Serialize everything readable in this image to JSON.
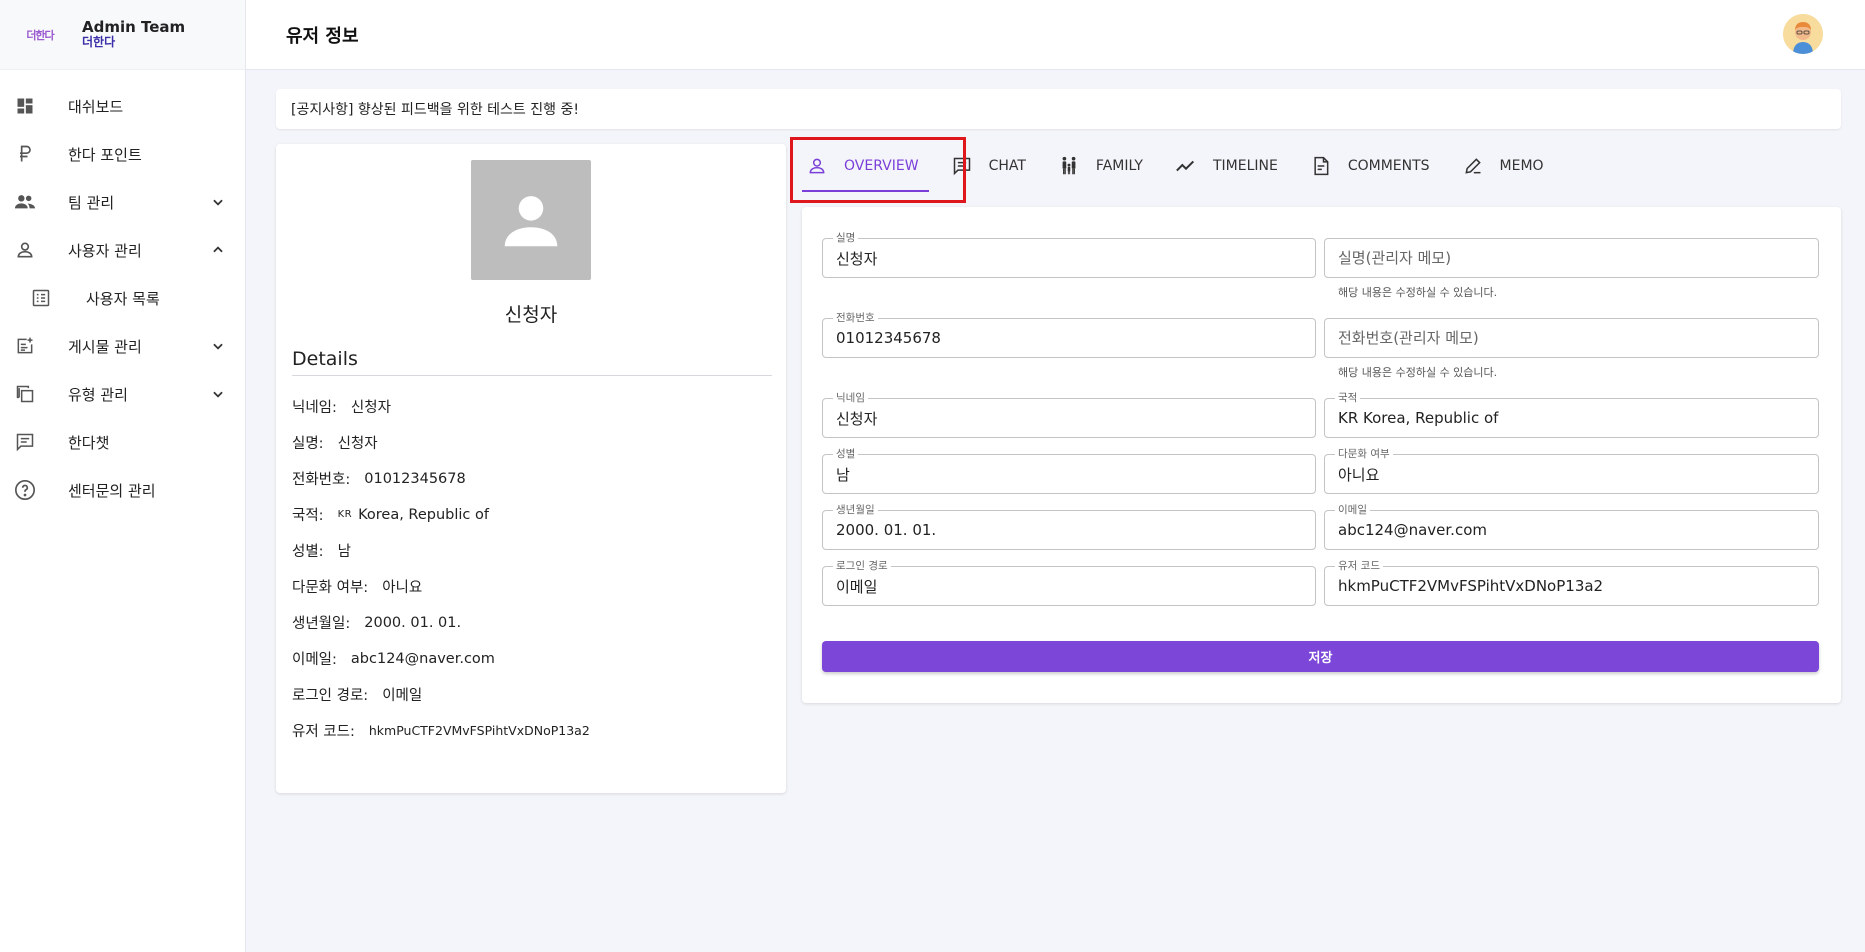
{
  "brand": {
    "logo_text": "더한다",
    "title": "Admin Team",
    "subtitle": "더한다"
  },
  "sidebar": {
    "items": [
      {
        "label": "대쉬보드",
        "icon": "dashboard-icon"
      },
      {
        "label": "한다 포인트",
        "icon": "ruble-icon"
      },
      {
        "label": "팀 관리",
        "icon": "group-icon",
        "chevron": "down"
      },
      {
        "label": "사용자 관리",
        "icon": "person-icon",
        "chevron": "up"
      },
      {
        "label": "사용자 목록",
        "icon": "list-icon",
        "sub": true
      },
      {
        "label": "게시물 관리",
        "icon": "post-add-icon",
        "chevron": "down"
      },
      {
        "label": "유형 관리",
        "icon": "copy-icon",
        "chevron": "down"
      },
      {
        "label": "한다챗",
        "icon": "chat-icon"
      },
      {
        "label": "센터문의 관리",
        "icon": "help-circle-icon"
      }
    ]
  },
  "header": {
    "title": "유저 정보"
  },
  "notice": {
    "text": "[공지사항] 향상된 피드백을 위한 테스트 진행 중!"
  },
  "profile": {
    "name": "신청자",
    "details_title": "Details",
    "rows": [
      {
        "key": "닉네임:",
        "value": "신청자"
      },
      {
        "key": "실명:",
        "value": "신청자"
      },
      {
        "key": "전화번호:",
        "value": "01012345678"
      },
      {
        "key": "국적:",
        "flag": "KR",
        "value": "Korea, Republic of"
      },
      {
        "key": "성별:",
        "value": "남"
      },
      {
        "key": "다문화 여부:",
        "value": "아니요"
      },
      {
        "key": "생년월일:",
        "value": "2000. 01. 01."
      },
      {
        "key": "이메일:",
        "value": "abc124@naver.com"
      },
      {
        "key": "로그인 경로:",
        "value": "이메일"
      },
      {
        "key": "유저 코드:",
        "value": "hkmPuCTF2VMvFSPihtVxDNoP13a2"
      }
    ]
  },
  "tabs": [
    {
      "label": "OVERVIEW",
      "icon": "person-outline-icon",
      "active": true
    },
    {
      "label": "CHAT",
      "icon": "chat-icon"
    },
    {
      "label": "FAMILY",
      "icon": "family-icon"
    },
    {
      "label": "TIMELINE",
      "icon": "timeline-icon"
    },
    {
      "label": "COMMENTS",
      "icon": "document-icon"
    },
    {
      "label": "MEMO",
      "icon": "pen-icon"
    }
  ],
  "form": {
    "real_name": {
      "label": "실명",
      "value": "신청자"
    },
    "real_name_memo": {
      "placeholder": "실명(관리자 메모)",
      "helper": "해당 내용은 수정하실 수 있습니다."
    },
    "phone": {
      "label": "전화번호",
      "value": "01012345678"
    },
    "phone_memo": {
      "placeholder": "전화번호(관리자 메모)",
      "helper": "해당 내용은 수정하실 수 있습니다."
    },
    "nickname": {
      "label": "닉네임",
      "value": "신청자"
    },
    "nationality": {
      "label": "국적",
      "value": "KR Korea, Republic of"
    },
    "gender": {
      "label": "성별",
      "value": "남"
    },
    "multicultural": {
      "label": "다문화 여부",
      "value": "아니요"
    },
    "birthdate": {
      "label": "생년월일",
      "value": "2000. 01. 01."
    },
    "email": {
      "label": "이메일",
      "value": "abc124@naver.com"
    },
    "login_method": {
      "label": "로그인 경로",
      "value": "이메일"
    },
    "user_code": {
      "label": "유저 코드",
      "value": "hkmPuCTF2VMvFSPihtVxDNoP13a2"
    },
    "save_label": "저장"
  },
  "colors": {
    "accent": "#7c46d8",
    "highlight": "#e0161d",
    "background": "#f4f5fa"
  }
}
